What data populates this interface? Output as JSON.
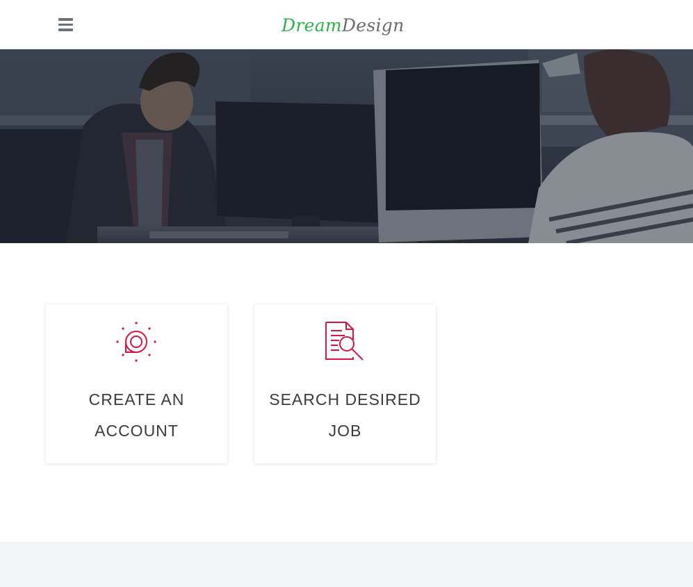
{
  "brand": {
    "logo_part1": "Dream",
    "logo_part2": "Design",
    "primary_color": "#2db24a",
    "secondary_color": "#6b6b6b",
    "accent_color": "#d6153e"
  },
  "header": {
    "menu_icon": "hamburger-menu-icon"
  },
  "hero": {
    "image": "office-workers-at-computers-photo"
  },
  "features": [
    {
      "line1": "CREATE AN",
      "line2": "ACCOUNT",
      "icon": "account-target-icon"
    },
    {
      "line1": "SEARCH DESIRED",
      "line2": "JOB",
      "icon": "document-search-icon"
    }
  ]
}
